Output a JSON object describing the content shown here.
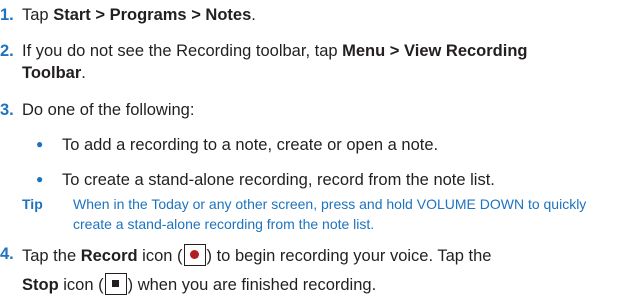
{
  "steps": [
    {
      "num": "1.",
      "pre": "Tap ",
      "bold": "Start > Programs > Notes",
      "post": "."
    },
    {
      "num": "2.",
      "pre": "If you do not see the Recording toolbar, tap ",
      "bold": "Menu > View Recording",
      "bold2": "Toolbar",
      "post": "."
    },
    {
      "num": "3.",
      "text": "Do one of the following:"
    },
    {
      "num": "4.",
      "pre": "Tap the ",
      "bold": "Record",
      "mid": " icon (",
      "after_icon": ") to begin recording your voice. Tap the",
      "bold2": "Stop",
      "mid2": " icon (",
      "after_icon2": ") when you are finished recording."
    }
  ],
  "bullets": [
    "To add a recording to a note, create or open a note.",
    "To create a stand-alone recording, record from the note list."
  ],
  "tip": {
    "label": "Tip",
    "text": "When in the Today or any other screen, press and hold VOLUME DOWN to quickly create a stand-alone recording from the note list."
  },
  "colors": {
    "accent": "#1e73be",
    "text": "#231f20",
    "record": "#b01e23"
  },
  "icons": {
    "record": "record-icon",
    "stop": "stop-icon"
  }
}
